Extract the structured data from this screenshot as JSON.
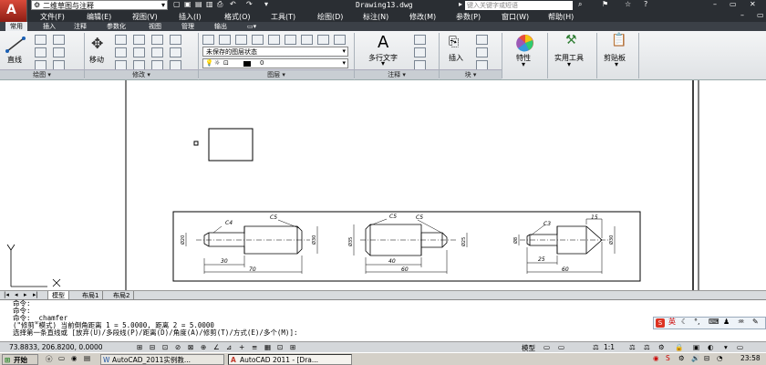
{
  "titlebar": {
    "workspace": "二维草图与注释",
    "document_title": "Drawing13.dwg",
    "search_placeholder": "键入关键字或短语"
  },
  "menubar": {
    "items": [
      "文件(F)",
      "编辑(E)",
      "视图(V)",
      "插入(I)",
      "格式(O)",
      "工具(T)",
      "绘图(D)",
      "标注(N)",
      "修改(M)",
      "参数(P)",
      "窗口(W)",
      "帮助(H)"
    ]
  },
  "ribbon_tabs": [
    "常用",
    "插入",
    "注释",
    "参数化",
    "视图",
    "管理",
    "输出"
  ],
  "ribbon": {
    "line_label": "直线",
    "move_label": "移动",
    "layer_state": "未保存的图层状态",
    "layer_value": "0",
    "mtext_label": "多行文字",
    "insert_label": "插入",
    "properties_label": "特性",
    "utilities_label": "实用工具",
    "clipboard_label": "剪贴板",
    "panels": {
      "draw": "绘图",
      "modify": "修改",
      "layers": "图层",
      "annotation": "注释",
      "block": "块"
    }
  },
  "drawing": {
    "part1": {
      "chamfer_left": "C4",
      "chamfer_right": "C5",
      "d1": "Ø20",
      "d2": "Ø30",
      "len1": "30",
      "len2": "70"
    },
    "part2": {
      "chamfer_left": "C5",
      "chamfer_right": "C5",
      "d1": "Ø35",
      "d2": "Ø25",
      "len1": "40",
      "len2": "60"
    },
    "part3": {
      "chamfer": "C3",
      "dim_top": "15",
      "d1": "Ø8",
      "d2": "Ø30",
      "len1": "25",
      "len2": "60"
    }
  },
  "sheet_tabs": [
    "模型",
    "布局1",
    "布局2"
  ],
  "command_history": [
    "命令:",
    "命令:",
    "命令:  _chamfer",
    "(\"修剪\"模式) 当前倒角距离 1 = 5.0000, 距离 2 = 5.0000",
    "选择第一条直线或 [放弃(U)/多段线(P)/距离(D)/角度(A)/修剪(T)/方式(E)/多个(M)]:"
  ],
  "status": {
    "coords": "73.8833,  206.8200,  0.0000",
    "mode": "模型",
    "scale": "1:1"
  },
  "ime": {
    "lang": "英"
  },
  "taskbar": {
    "start": "开始",
    "tasks": [
      "AutoCAD_2011实例教...",
      "AutoCAD 2011 - [Dra..."
    ],
    "clock": "23:58"
  }
}
